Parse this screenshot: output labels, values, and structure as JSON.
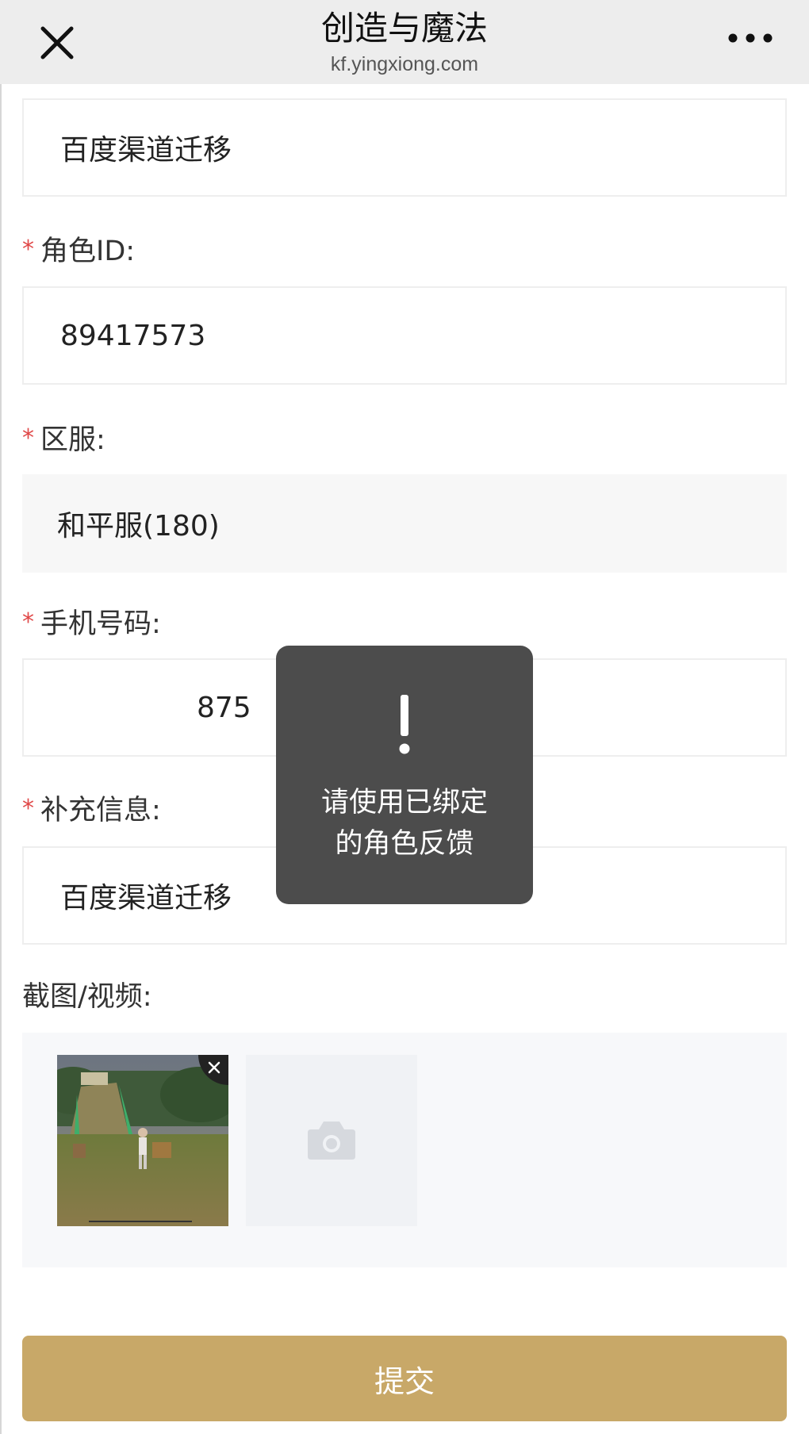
{
  "header": {
    "title": "创造与魔法",
    "url": "kf.yingxiong.com",
    "close_icon": "close-icon",
    "more_icon": "more-icon"
  },
  "form": {
    "top_field_value": "百度渠道迁移",
    "role_id": {
      "required_mark": "*",
      "label": "角色ID:",
      "value": "89417573"
    },
    "server": {
      "required_mark": "*",
      "label": "区服:",
      "value": "和平服(180)"
    },
    "phone": {
      "required_mark": "*",
      "label": "手机号码:",
      "value": "875"
    },
    "extra_info": {
      "required_mark": "*",
      "label": "补充信息:",
      "value": "百度渠道迁移"
    },
    "media": {
      "label": "截图/视频:",
      "thumb_icon": "game-screenshot-thumbnail",
      "delete_icon": "close-icon",
      "upload_icon": "camera-icon"
    },
    "submit_label": "提交"
  },
  "toast": {
    "icon": "exclamation-icon",
    "line1": "请使用已绑定",
    "line2": "的角色反馈"
  },
  "colors": {
    "accent": "#c8a868",
    "required": "#e04848",
    "toast_bg": "#4c4c4c",
    "header_bg": "#ededed"
  }
}
